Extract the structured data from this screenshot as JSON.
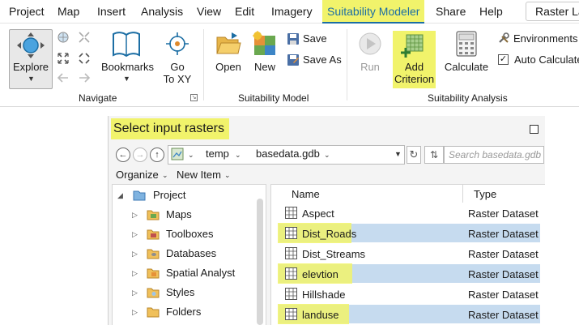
{
  "menu": {
    "items": [
      "Project",
      "Map",
      "Insert",
      "Analysis",
      "View",
      "Edit",
      "Imagery",
      "Suitability Modeler",
      "Share",
      "Help"
    ],
    "active": "Suitability Modeler",
    "extra_tab": "Raster La"
  },
  "ribbon": {
    "navigate": {
      "group_label": "Navigate",
      "explore_label": "Explore",
      "bookmarks_label": "Bookmarks",
      "goto_line1": "Go",
      "goto_line2": "To XY"
    },
    "model": {
      "group_label": "Suitability Model",
      "open_label": "Open",
      "new_label": "New",
      "save_label": "Save",
      "save_as_label": "Save As"
    },
    "analysis": {
      "group_label": "Suitability Analysis",
      "run_label": "Run",
      "add_line1": "Add",
      "add_line2": "Criterion",
      "calculate_label": "Calculate",
      "environments_label": "Environments",
      "auto_calculate_label": "Auto Calculate",
      "auto_calculate_checked": true
    }
  },
  "dialog": {
    "title": "Select input rasters",
    "path": {
      "segment1": "temp",
      "segment2": "basedata.gdb"
    },
    "search_placeholder": "Search basedata.gdb",
    "toolbar": {
      "organize": "Organize",
      "new_item": "New Item"
    },
    "tree": {
      "root": "Project",
      "children": [
        "Maps",
        "Toolboxes",
        "Databases",
        "Spatial Analyst",
        "Styles",
        "Folders"
      ]
    },
    "columns": {
      "name": "Name",
      "type": "Type"
    },
    "rows": [
      {
        "name": "Aspect",
        "type": "Raster Dataset",
        "selected": false
      },
      {
        "name": "Dist_Roads",
        "type": "Raster Dataset",
        "selected": true
      },
      {
        "name": "Dist_Streams",
        "type": "Raster Dataset",
        "selected": false
      },
      {
        "name": "elevtion",
        "type": "Raster Dataset",
        "selected": true
      },
      {
        "name": "Hillshade",
        "type": "Raster Dataset",
        "selected": false
      },
      {
        "name": "landuse",
        "type": "Raster Dataset",
        "selected": true
      }
    ]
  },
  "colors": {
    "highlight": "#f1f36b",
    "selection": "#c6dbef",
    "accent": "#1c6ea4"
  }
}
